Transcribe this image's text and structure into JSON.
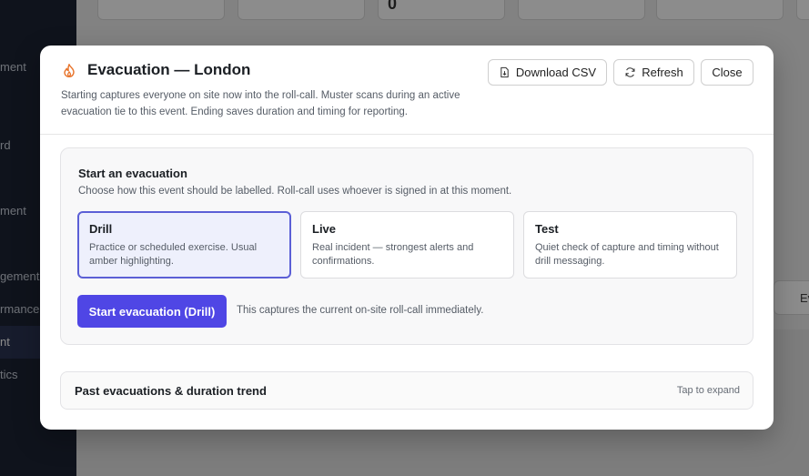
{
  "background": {
    "sidebar_items": [
      {
        "label": "ment",
        "active": false
      },
      {
        "label": "rd",
        "active": false
      },
      {
        "label": "ment",
        "active": false
      },
      {
        "label": "gement",
        "active": false
      },
      {
        "label": "rmance",
        "active": false
      },
      {
        "label": "nt",
        "active": true
      },
      {
        "label": "tics",
        "active": false
      }
    ],
    "stat_value": "0",
    "pill_label": "Ev"
  },
  "modal": {
    "title": "Evacuation — London",
    "description": "Starting captures everyone on site now into the roll-call. Muster scans during an active evacuation tie to this event. Ending saves duration and timing for reporting.",
    "buttons": {
      "download": "Download CSV",
      "refresh": "Refresh",
      "close": "Close"
    },
    "start_section": {
      "title": "Start an evacuation",
      "subtitle": "Choose how this event should be labelled. Roll-call uses whoever is signed in at this moment.",
      "options": [
        {
          "title": "Drill",
          "desc": "Practice or scheduled exercise. Usual amber highlighting.",
          "selected": true
        },
        {
          "title": "Live",
          "desc": "Real incident — strongest alerts and confirmations.",
          "selected": false
        },
        {
          "title": "Test",
          "desc": "Quiet check of capture and timing without drill messaging.",
          "selected": false
        }
      ],
      "start_button": "Start evacuation (Drill)",
      "note": "This captures the current on-site roll-call immediately."
    },
    "past": {
      "title": "Past evacuations & duration trend",
      "hint": "Tap to expand"
    }
  },
  "colors": {
    "accent": "#4f46e5",
    "icon_orange": "#e8742c",
    "sidebar_bg": "#1d2333"
  }
}
